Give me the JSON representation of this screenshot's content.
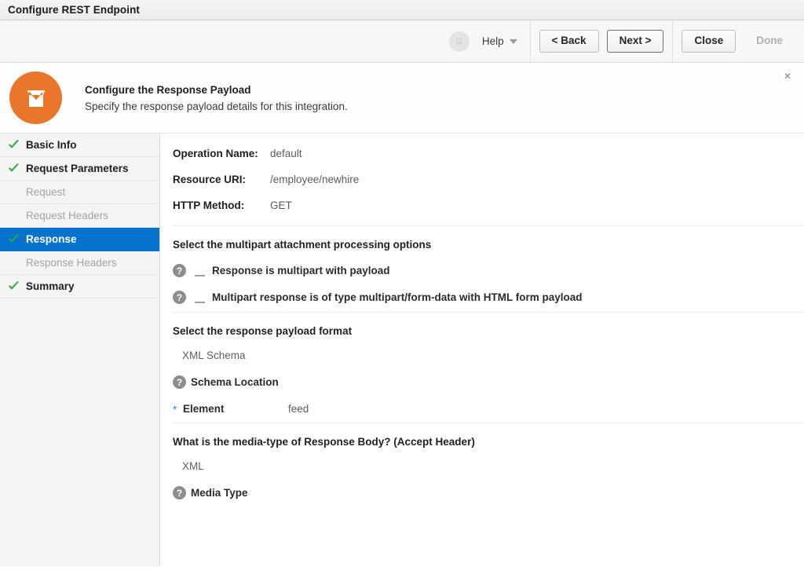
{
  "window": {
    "title": "Configure REST Endpoint"
  },
  "toolbar": {
    "status_icon": "circle-badge-icon",
    "help_label": "Help",
    "back_label": "< Back",
    "next_label": "Next >",
    "close_label": "Close",
    "done_label": "Done"
  },
  "header": {
    "brand_icon": "inbox-tray-icon",
    "title": "Configure the Response Payload",
    "subtitle": "Specify the response payload details for this integration.",
    "close_icon": "×"
  },
  "sidebar": {
    "items": [
      {
        "label": "Basic Info",
        "state": "done"
      },
      {
        "label": "Request Parameters",
        "state": "done"
      },
      {
        "label": "Request",
        "state": "muted"
      },
      {
        "label": "Request Headers",
        "state": "muted"
      },
      {
        "label": "Response",
        "state": "selected"
      },
      {
        "label": "Response Headers",
        "state": "muted"
      },
      {
        "label": "Summary",
        "state": "done"
      }
    ]
  },
  "main": {
    "info_rows": [
      {
        "label": "Operation Name:",
        "value": "default"
      },
      {
        "label": "Resource URI:",
        "value": "/employee/newhire"
      },
      {
        "label": "HTTP Method:",
        "value": "GET"
      }
    ],
    "multipart": {
      "section_title": "Select the multipart attachment processing options",
      "options": [
        {
          "help_icon": "help-icon",
          "label": "Response is multipart with payload",
          "checked": false
        },
        {
          "help_icon": "help-icon",
          "label": "Multipart response is of type multipart/form-data with HTML form payload",
          "checked": false
        }
      ]
    },
    "payload_format": {
      "section_title": "Select the response payload format",
      "format_value": "XML Schema",
      "schema_location_label": "Schema Location",
      "element_label": "Element",
      "element_value": "feed",
      "required_marker": "*"
    },
    "media_type": {
      "section_title": "What is the media-type of Response Body? (Accept Header)",
      "value": "XML",
      "label": "Media Type"
    }
  },
  "colors": {
    "brand_orange": "#e8762c",
    "selection_blue": "#0572ce",
    "check_green": "#2eab3c",
    "required_star": "#2a7dc9"
  }
}
